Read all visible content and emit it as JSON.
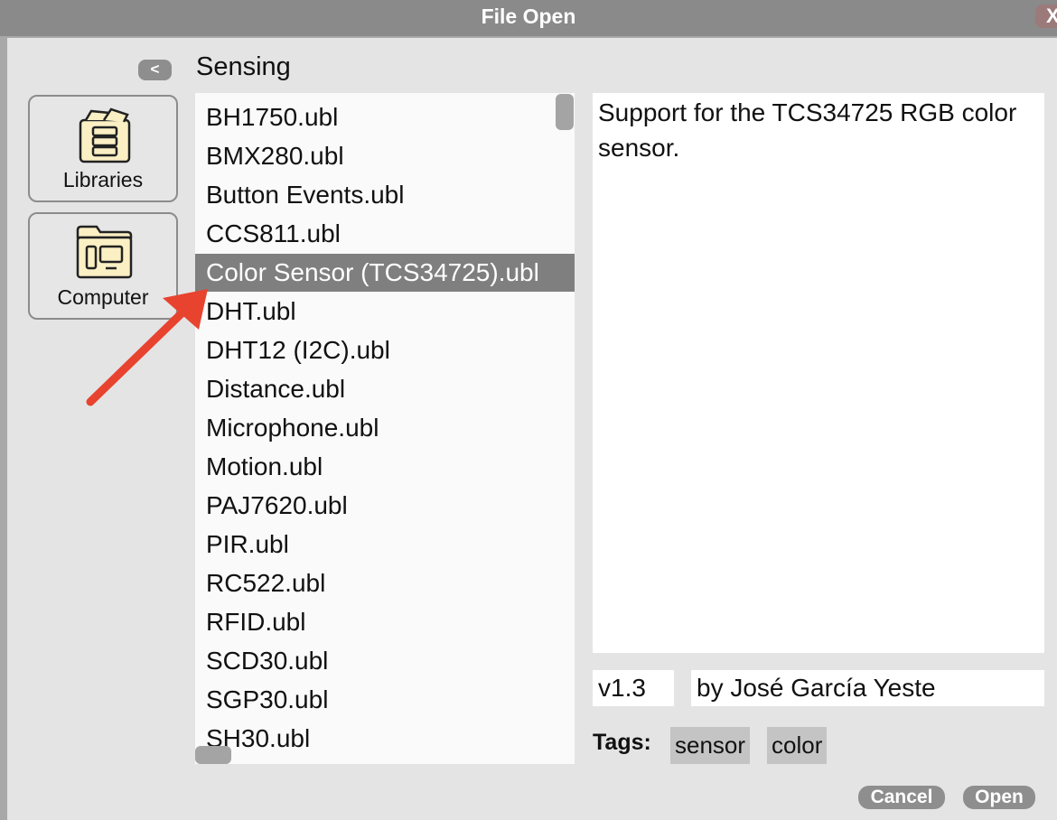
{
  "window": {
    "title": "File Open",
    "close_label": "X"
  },
  "nav": {
    "back_label": "<",
    "folder_title": "Sensing"
  },
  "sidebar": {
    "items": [
      {
        "label": "Libraries",
        "icon": "libraries-icon"
      },
      {
        "label": "Computer",
        "icon": "computer-folder-icon"
      }
    ]
  },
  "file_list": {
    "selected_index": 4,
    "items": [
      "BH1750.ubl",
      "BMX280.ubl",
      "Button Events.ubl",
      "CCS811.ubl",
      "Color Sensor (TCS34725).ubl",
      "DHT.ubl",
      "DHT12 (I2C).ubl",
      "Distance.ubl",
      "Microphone.ubl",
      "Motion.ubl",
      "PAJ7620.ubl",
      "PIR.ubl",
      "RC522.ubl",
      "RFID.ubl",
      "SCD30.ubl",
      "SGP30.ubl",
      "SH30.ubl"
    ]
  },
  "details": {
    "description": "Support for the TCS34725 RGB color sensor.",
    "version": "v1.3",
    "author": "by José García Yeste",
    "tags_label": "Tags:",
    "tags": [
      "sensor",
      "color"
    ]
  },
  "actions": {
    "cancel_label": "Cancel",
    "open_label": "Open"
  },
  "colors": {
    "selection": "#7f7f7f",
    "annotation_arrow": "#e8432f"
  }
}
